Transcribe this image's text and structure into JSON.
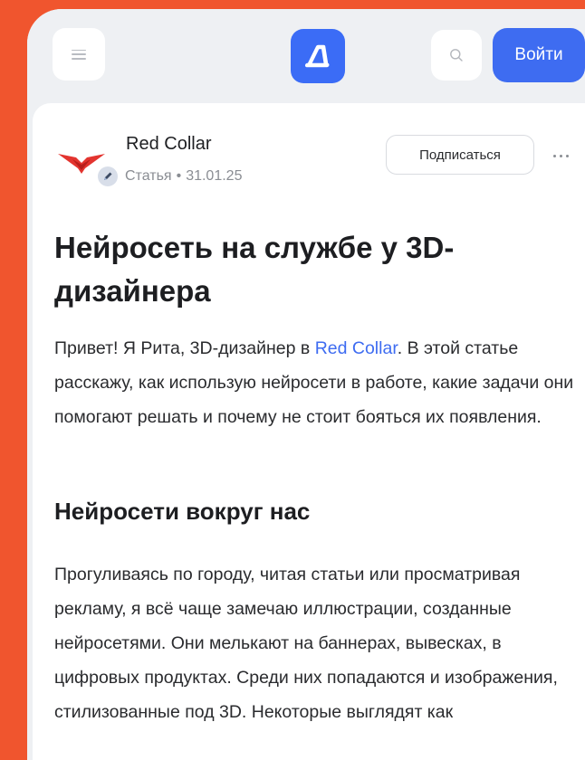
{
  "header": {
    "menu_icon": "hamburger-menu-icon",
    "logo_icon": "app-logo-icon",
    "search_icon": "search-icon",
    "login_label": "Войти",
    "accent_color": "#3e6cf1"
  },
  "author": {
    "name": "Red Collar",
    "logo_icon": "red-collar-logo-icon",
    "verified_icon": "pencil-badge-icon",
    "meta_type": "Статья",
    "meta_separator": "•",
    "date": "31.01.25",
    "subscribe_label": "Подписаться",
    "more_icon": "more-dots-icon"
  },
  "article": {
    "title": "Нейросеть на службе у 3D-дизайнера",
    "intro_before": "Привет! Я Рита, 3D-дизайнер в ",
    "intro_link": "Red Collar",
    "intro_after": ". В этой статье расскажу, как использую нейросети в работе, какие задачи они помогают решать и почему не стоит бояться их появления.",
    "section_heading": "Нейросети вокруг нас",
    "section_body": "Прогуливаясь по городу, читая статьи или просматривая рекламу, я всё чаще замечаю иллюстрации, созданные нейросетями. Они мелькают на баннерах, вывесках, в цифровых продуктах. Среди них попадаются и изображения, стилизованные под 3D. Некоторые выглядят как"
  },
  "colors": {
    "frame": "#f0552e",
    "brand_red": "#e3342f"
  }
}
